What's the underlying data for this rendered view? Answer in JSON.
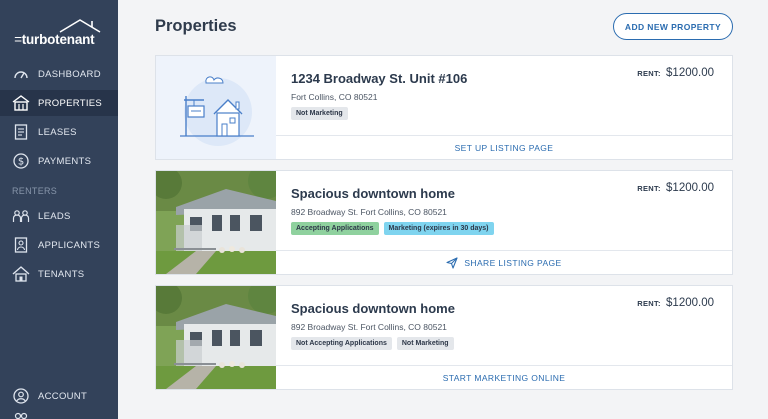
{
  "brand": {
    "name": "turbotenant"
  },
  "sidebar": {
    "items": [
      {
        "label": "DASHBOARD",
        "icon": "dashboard-icon"
      },
      {
        "label": "PROPERTIES",
        "icon": "building-icon"
      },
      {
        "label": "LEASES",
        "icon": "document-icon"
      },
      {
        "label": "PAYMENTS",
        "icon": "dollar-icon"
      }
    ],
    "section_label": "RENTERS",
    "renter_items": [
      {
        "label": "LEADS",
        "icon": "people-icon"
      },
      {
        "label": "APPLICANTS",
        "icon": "applicant-icon"
      },
      {
        "label": "TENANTS",
        "icon": "house-icon"
      }
    ],
    "account": {
      "label": "ACCOUNT",
      "icon": "account-icon"
    }
  },
  "header": {
    "title": "Properties",
    "add_button": "ADD NEW PROPERTY"
  },
  "properties": [
    {
      "name": "1234 Broadway St. Unit #106",
      "address": "Fort Collins, CO 80521",
      "rent_label": "RENT:",
      "rent": "$1200.00",
      "badges": [
        "Not Marketing"
      ],
      "action": "SET UP LISTING PAGE"
    },
    {
      "name": "Spacious downtown home",
      "address": "892 Broadway St. Fort Collins, CO 80521",
      "rent_label": "RENT:",
      "rent": "$1200.00",
      "badges": [
        "Accepting Applications",
        "Marketing (expires in 30 days)"
      ],
      "action": "SHARE LISTING PAGE"
    },
    {
      "name": "Spacious downtown home",
      "address": "892 Broadway St. Fort Collins, CO 80521",
      "rent_label": "RENT:",
      "rent": "$1200.00",
      "badges": [
        "Not Accepting Applications",
        "Not Marketing"
      ],
      "action": "START MARKETING ONLINE"
    }
  ],
  "colors": {
    "sidebar": "#33425a",
    "sidebar_active": "#27344a",
    "accent": "#2b6cb0",
    "green_badge": "#8fd19e",
    "blue_badge": "#7fd4ef"
  }
}
